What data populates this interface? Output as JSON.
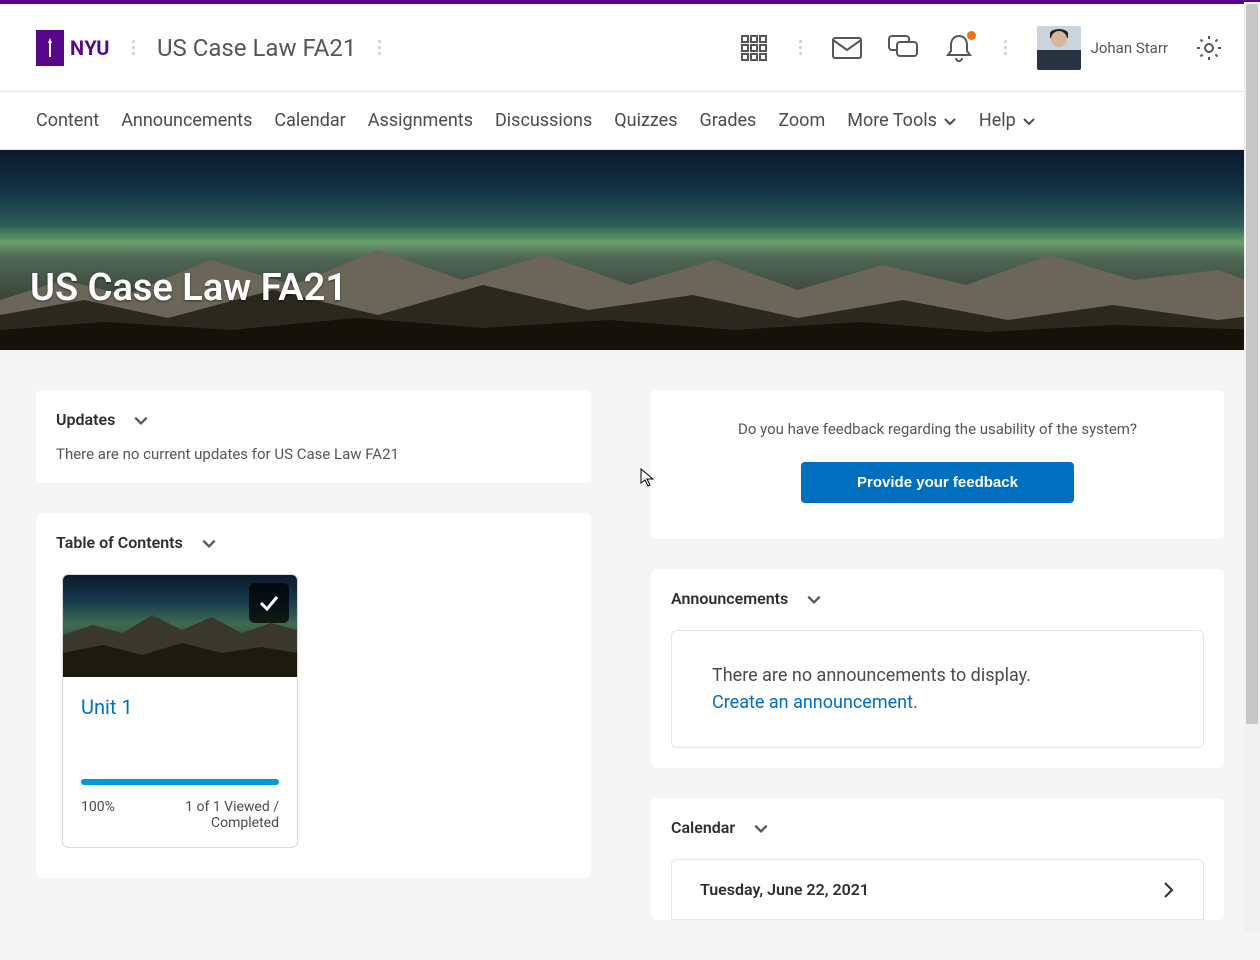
{
  "brand": {
    "text": "NYU"
  },
  "header": {
    "course_title": "US Case Law FA21",
    "user_name": "Johan Starr"
  },
  "nav": {
    "items": [
      "Content",
      "Announcements",
      "Calendar",
      "Assignments",
      "Discussions",
      "Quizzes",
      "Grades",
      "Zoom"
    ],
    "more_tools": "More Tools",
    "help": "Help"
  },
  "banner": {
    "title": "US Case Law FA21"
  },
  "updates": {
    "heading": "Updates",
    "empty_text": "There are no current updates for US Case Law FA21"
  },
  "toc": {
    "heading": "Table of Contents",
    "unit": {
      "title": "Unit 1",
      "percent": "100%",
      "status": "1 of 1 Viewed / Completed"
    }
  },
  "feedback": {
    "prompt": "Do you have feedback regarding the usability of the system?",
    "button": "Provide your feedback"
  },
  "announcements": {
    "heading": "Announcements",
    "empty_text": "There are no announcements to display.",
    "create_link": "Create an announcement."
  },
  "calendar": {
    "heading": "Calendar",
    "date": "Tuesday, June 22, 2021"
  },
  "colors": {
    "brand_purple": "#57068c",
    "link_blue": "#006fbf",
    "progress_blue": "#009ae0",
    "notif_orange": "#e87511"
  }
}
